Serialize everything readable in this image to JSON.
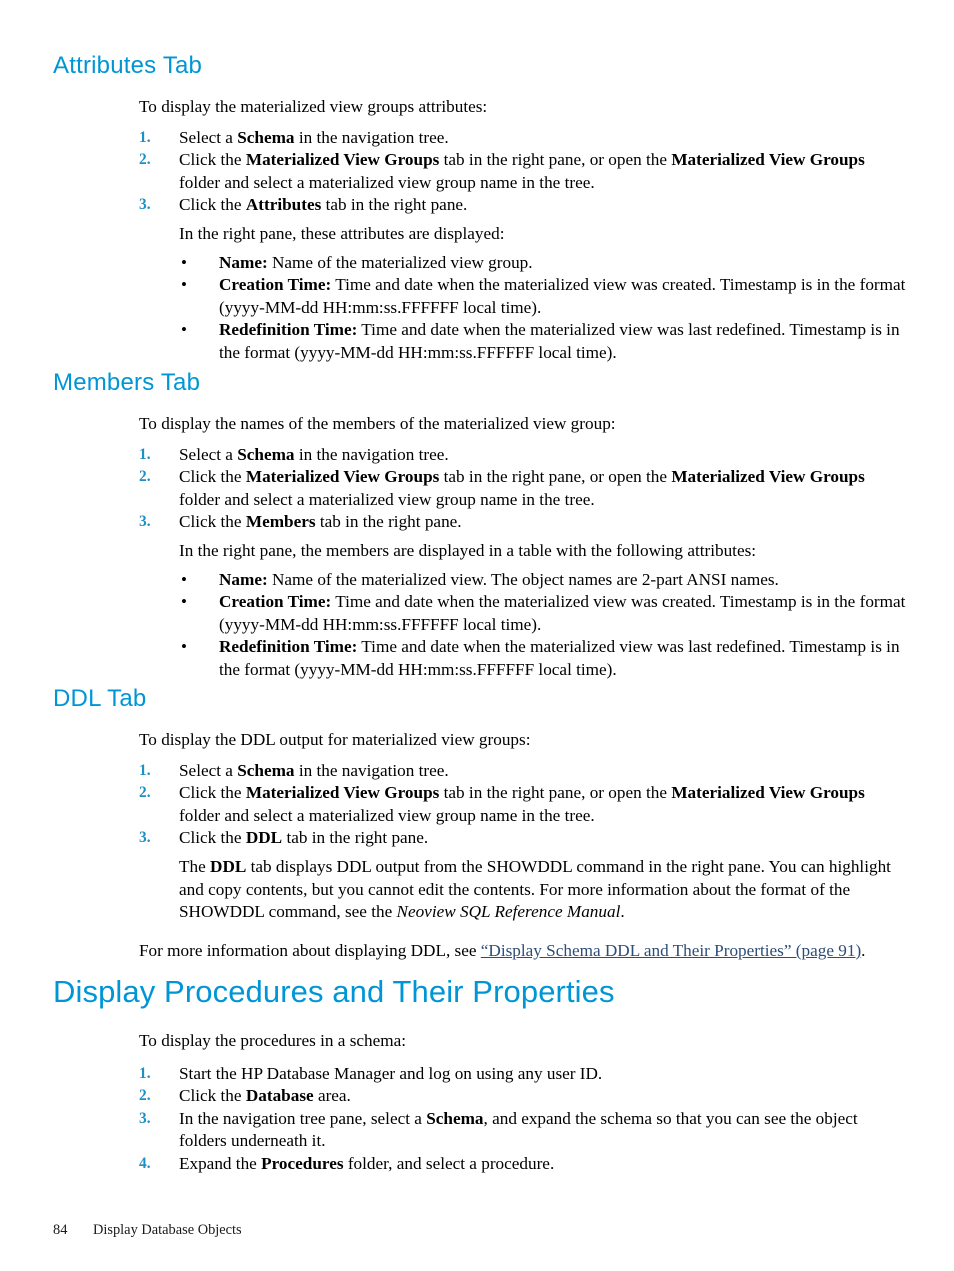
{
  "document": {
    "footer": {
      "page_number": "84",
      "section_title": "Display Database Objects"
    }
  },
  "sections": [
    {
      "id": "attributes-tab",
      "heading": "Attributes Tab",
      "intro": "To display the materialized view groups attributes:",
      "steps": [
        {
          "num": "1.",
          "text_html": "Select a <b>Schema</b> in the navigation tree."
        },
        {
          "num": "2.",
          "text_html": "Click the <b>Materialized View Groups</b> tab in the right pane, or open the <b>Materialized View Groups</b> folder and select a materialized view group name in the tree."
        },
        {
          "num": "3.",
          "text_html": "Click the <b>Attributes</b> tab in the right pane."
        }
      ],
      "post_note": "In the right pane, these attributes are displayed:",
      "bullets": [
        {
          "marker": "•",
          "text_html": "<b>Name:</b> Name of the materialized view group."
        },
        {
          "marker": "•",
          "text_html": "<b>Creation Time:</b> Time and date when the materialized view was created. Timestamp is in the format (yyyy-MM-dd HH:mm:ss.FFFFFF local time)."
        },
        {
          "marker": "•",
          "text_html": "<b>Redefinition Time:</b> Time and date when the materialized view was last redefined. Timestamp is in the format (yyyy-MM-dd HH:mm:ss.FFFFFF local time)."
        }
      ]
    },
    {
      "id": "members-tab",
      "heading": "Members Tab",
      "intro": "To display the names of the members of the materialized view group:",
      "steps": [
        {
          "num": "1.",
          "text_html": "Select a <b>Schema</b> in the navigation tree."
        },
        {
          "num": "2.",
          "text_html": "Click the <b>Materialized View Groups</b> tab in the right pane, or open the <b>Materialized View Groups</b> folder and select a materialized view group name in the tree."
        },
        {
          "num": "3.",
          "text_html": "Click the <b>Members</b> tab in the right pane."
        }
      ],
      "post_note": "In the right pane, the members are displayed in a table with the following attributes:",
      "bullets": [
        {
          "marker": "•",
          "text_html": "<b>Name:</b> Name of the materialized view. The object names are 2-part ANSI names."
        },
        {
          "marker": "•",
          "text_html": "<b>Creation Time:</b> Time and date when the materialized view was created. Timestamp is in the format (yyyy-MM-dd HH:mm:ss.FFFFFF local time)."
        },
        {
          "marker": "•",
          "text_html": "<b>Redefinition Time:</b> Time and date when the materialized view was last redefined. Timestamp is in the format (yyyy-MM-dd HH:mm:ss.FFFFFF local time)."
        }
      ]
    },
    {
      "id": "ddl-tab",
      "heading": "DDL Tab",
      "intro": "To display the DDL output for materialized view groups:",
      "steps": [
        {
          "num": "1.",
          "text_html": "Select a <b>Schema</b> in the navigation tree."
        },
        {
          "num": "2.",
          "text_html": "Click the <b>Materialized View Groups</b> tab in the right pane, or open the <b>Materialized View Groups</b> folder and select a materialized view group name in the tree."
        },
        {
          "num": "3.",
          "text_html": "Click the <b>DDL</b> tab in the right pane."
        }
      ],
      "post_note_html": "The <b>DDL</b> tab displays DDL output from the SHOWDDL command in the right pane. You can highlight and copy contents, but you cannot edit the contents. For more information about the format of the SHOWDDL command, see the <i>Neoview SQL Reference Manual</i>.",
      "cross_reference_html": "For more information about displaying DDL, see <a class=\"xref\" href=\"#\">“Display Schema DDL and Their Properties” (page 91)</a>."
    },
    {
      "id": "display-procedures",
      "heading": "Display Procedures and Their Properties",
      "intro": "To display the procedures in a schema:",
      "steps": [
        {
          "num": "1.",
          "text_html": "Start the HP Database Manager and log on using any user ID."
        },
        {
          "num": "2.",
          "text_html": "Click the <b>Database</b> area."
        },
        {
          "num": "3.",
          "text_html": "In the navigation tree pane, select a <b>Schema</b>, and expand the schema so that you can see the object folders underneath it."
        },
        {
          "num": "4.",
          "text_html": "Expand the <b>Procedures</b> folder, and select a procedure."
        }
      ]
    }
  ],
  "colors": {
    "heading_blue": "#0096d6",
    "list_number_blue": "#1f8fc4",
    "crossref_blue": "#2d4d77",
    "body_text": "#000000",
    "page_background": "#ffffff"
  }
}
